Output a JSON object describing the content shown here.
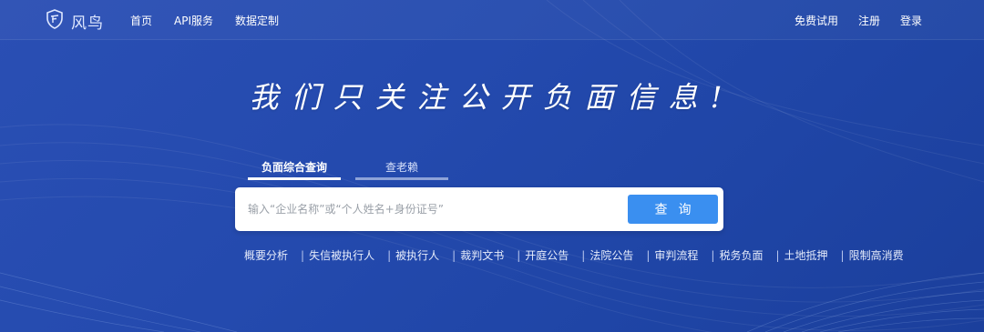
{
  "logo": {
    "icon": "shield-icon",
    "text": "风鸟"
  },
  "nav": {
    "left": [
      "首页",
      "API服务",
      "数据定制"
    ],
    "right": [
      "免费试用",
      "注册",
      "登录"
    ]
  },
  "slogan": "我们只关注公开负面信息!",
  "tabs": [
    {
      "label": "负面综合查询",
      "active": true
    },
    {
      "label": "查老赖",
      "active": false
    }
  ],
  "search": {
    "placeholder": "输入“企业名称”或“个人姓名+身份证号”",
    "value": "",
    "button_label": "查询"
  },
  "quick_links": [
    "概要分析",
    "失信被执行人",
    "被执行人",
    "裁判文书",
    "开庭公告",
    "法院公告",
    "审判流程",
    "税务负面",
    "土地抵押",
    "限制高消费"
  ],
  "colors": {
    "background": "#244aae",
    "search_button": "#3a8ff0",
    "search_box": "#ffffff"
  }
}
